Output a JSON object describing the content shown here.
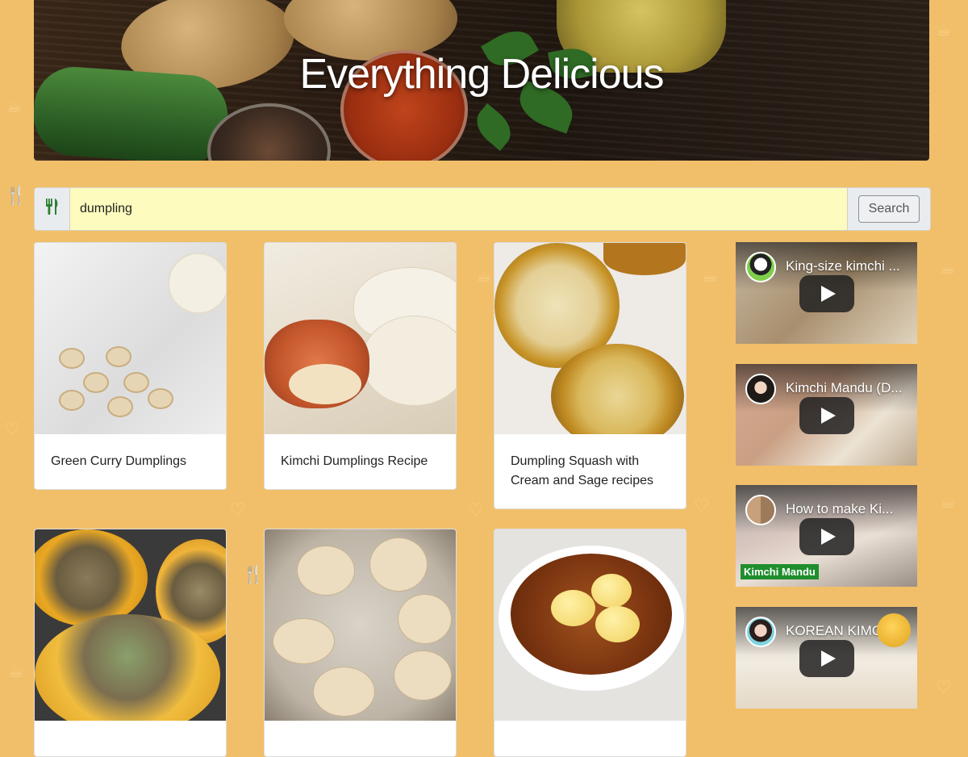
{
  "hero": {
    "title": "Everything Delicious"
  },
  "search": {
    "value": "dumpling",
    "button_label": "Search",
    "icon": "utensils-icon"
  },
  "recipes": [
    {
      "title": "Green Curry Dumplings"
    },
    {
      "title": "Kimchi Dumplings Recipe"
    },
    {
      "title": "Dumpling Squash with Cream and Sage recipes"
    },
    {
      "title": ""
    },
    {
      "title": ""
    },
    {
      "title": ""
    }
  ],
  "videos": [
    {
      "title": "King-size kimchi ...",
      "overlay_tag": ""
    },
    {
      "title": "Kimchi Mandu (D...",
      "overlay_tag": ""
    },
    {
      "title": "How to make Ki...",
      "overlay_tag": "Kimchi Mandu"
    },
    {
      "title": "KOREAN KIMCHI...",
      "overlay_tag": ""
    }
  ],
  "colors": {
    "page_bg": "#f1bf6a",
    "search_bg": "#fdfbbd",
    "icon_green": "#2e7d32"
  }
}
